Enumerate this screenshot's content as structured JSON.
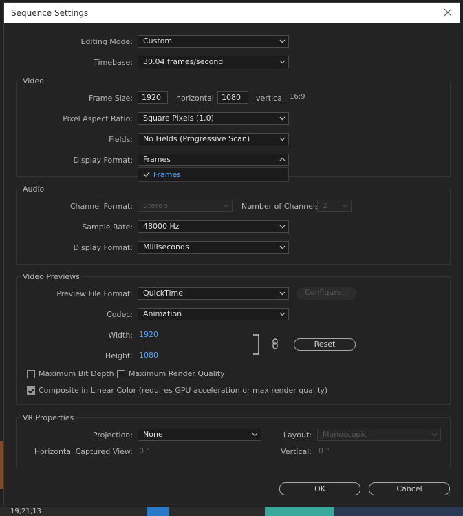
{
  "window": {
    "title": "Sequence Settings"
  },
  "general": {
    "editing_mode_label": "Editing Mode:",
    "editing_mode_value": "Custom",
    "timebase_label": "Timebase:",
    "timebase_value": "30.04  frames/second"
  },
  "video": {
    "group_title": "Video",
    "frame_size_label": "Frame Size:",
    "frame_width": "1920",
    "horizontal_label": "horizontal",
    "frame_height": "1080",
    "vertical_label": "vertical",
    "aspect": "16:9",
    "pixel_aspect_label": "Pixel Aspect Ratio:",
    "pixel_aspect_value": "Square Pixels (1.0)",
    "fields_label": "Fields:",
    "fields_value": "No Fields (Progressive Scan)",
    "display_format_label": "Display Format:",
    "display_format_value": "Frames",
    "dropdown_options": [
      "Frames"
    ]
  },
  "audio": {
    "group_title": "Audio",
    "channel_format_label": "Channel Format:",
    "channel_format_value": "Stereo",
    "num_channels_label": "Number of Channels:",
    "num_channels_value": "2",
    "sample_rate_label": "Sample Rate:",
    "sample_rate_value": "48000 Hz",
    "display_format_label": "Display Format:",
    "display_format_value": "Milliseconds"
  },
  "previews": {
    "group_title": "Video Previews",
    "file_format_label": "Preview File Format:",
    "file_format_value": "QuickTime",
    "configure_label": "Configure...",
    "codec_label": "Codec:",
    "codec_value": "Animation",
    "width_label": "Width:",
    "width_value": "1920",
    "height_label": "Height:",
    "height_value": "1080",
    "reset_label": "Reset",
    "max_bit_depth_label": "Maximum Bit Depth",
    "max_render_quality_label": "Maximum Render Quality",
    "linear_color_label": "Composite in Linear Color (requires GPU acceleration or max render quality)",
    "max_bit_depth_checked": false,
    "max_render_quality_checked": false,
    "linear_color_checked": true
  },
  "vr": {
    "group_title": "VR Properties",
    "projection_label": "Projection:",
    "projection_value": "None",
    "layout_label": "Layout:",
    "layout_value": "Monoscopic",
    "h_captured_label": "Horizontal Captured View:",
    "h_captured_value": "0 °",
    "vertical_label": "Vertical:",
    "vertical_value": "0 °"
  },
  "footer": {
    "ok_label": "OK",
    "cancel_label": "Cancel"
  },
  "background": {
    "timecode": "19;21;13"
  },
  "colors": {
    "accent": "#5aa0f0",
    "dialog_bg": "#232323",
    "title_bar": "#ffffff"
  }
}
